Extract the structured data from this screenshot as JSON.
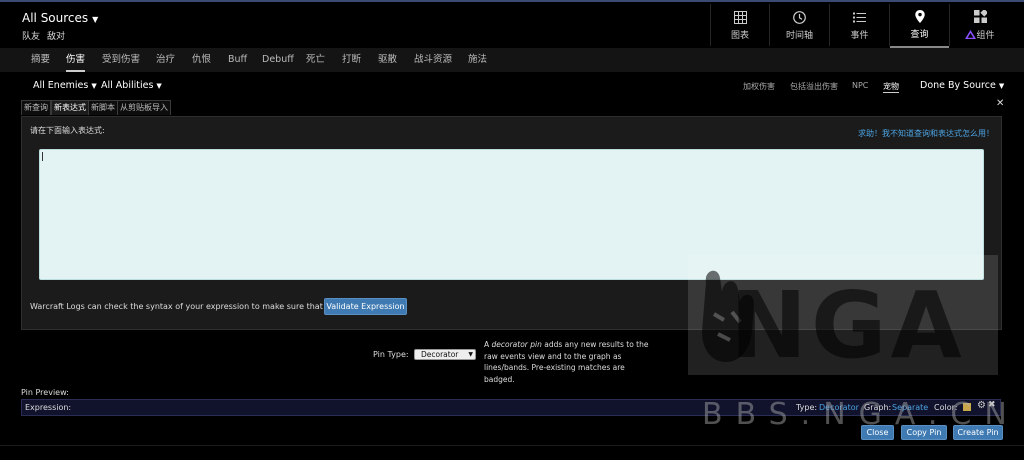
{
  "header": {
    "source_title": "All Sources",
    "subtitle": [
      "队友",
      "敌对"
    ],
    "nav": [
      {
        "label": "图表",
        "icon": "grid-icon"
      },
      {
        "label": "时间轴",
        "icon": "clock-icon"
      },
      {
        "label": "事件",
        "icon": "list-icon"
      },
      {
        "label": "查询",
        "icon": "map-pin-icon",
        "active": true
      },
      {
        "label": "组件",
        "icon": "widgets-icon"
      }
    ]
  },
  "subnav": [
    "摘要",
    "伤害",
    "受到伤害",
    "治疗",
    "仇恨",
    "Buff",
    "Debuff",
    "死亡",
    "打断",
    "驱散",
    "战斗资源",
    "施法"
  ],
  "filters": {
    "enemies": "All Enemies",
    "abilities": "All Abilities",
    "options": [
      "加权伤害",
      "包括溢出伤害",
      "NPC",
      "宠物"
    ],
    "done_by": "Done By Source"
  },
  "query_tabs": [
    "新查询",
    "新表达式",
    "新脚本",
    "从剪贴板导入"
  ],
  "expression": {
    "prompt": "请在下面输入表达式:",
    "help": "求助！我不知道查询和表达式怎么用！",
    "value": "",
    "validate_text": "Warcraft Logs can check the syntax of your expression to make sure that it is valid:",
    "validate_button": "Validate Expression"
  },
  "pin": {
    "type_label": "Pin Type:",
    "type_value": "Decorator",
    "desc_pre": "A ",
    "desc_em": "decorator pin",
    "desc_post": " adds any new results to the raw events view and to the graph as lines/bands. Pre-existing matches are badged."
  },
  "preview": {
    "label": "Pin Preview:",
    "expression_label": "Expression:",
    "type_label": "Type:",
    "type_value": "Decorator",
    "graph_label": "Graph:",
    "graph_value": "Separate",
    "color_label": "Color:",
    "color": "#c8a64a"
  },
  "buttons": {
    "close": "Close",
    "copy": "Copy Pin",
    "create": "Create Pin"
  },
  "watermark": {
    "logo": "NGA",
    "url": "BBS.NGA.CN"
  }
}
